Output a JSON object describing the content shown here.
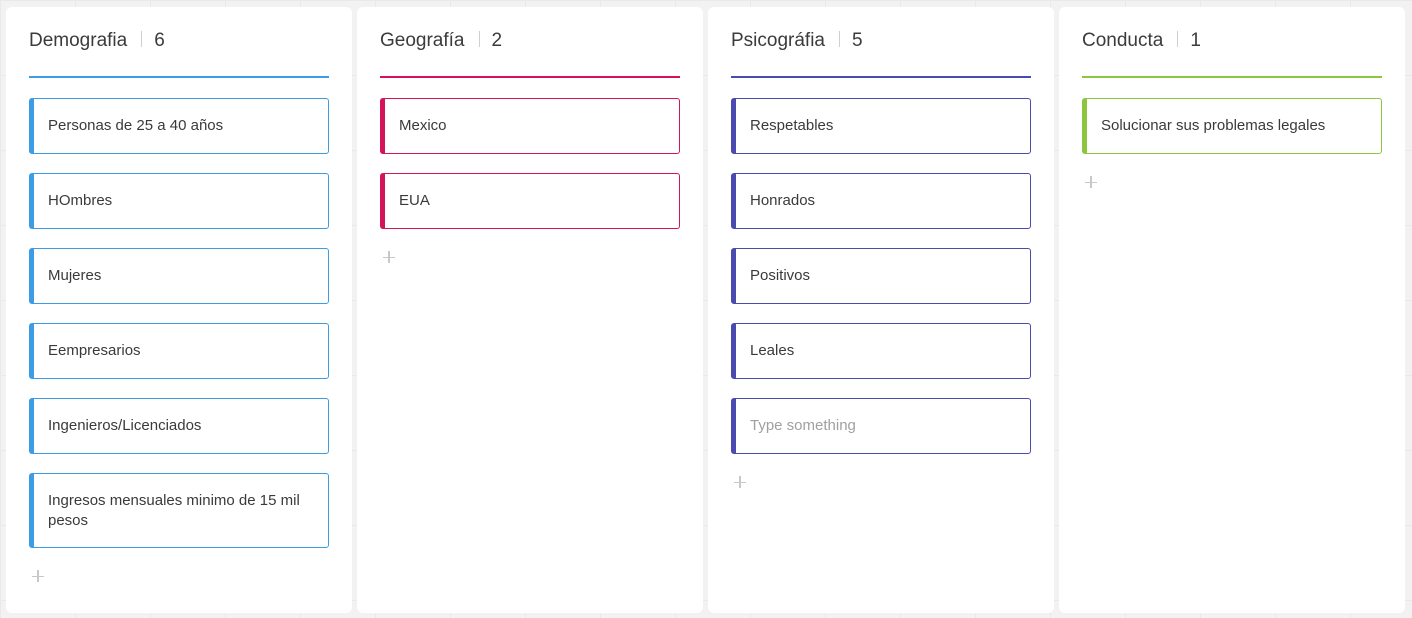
{
  "columns": [
    {
      "title": "Demografia",
      "count": "6",
      "color": "#3d9ce6",
      "cards": [
        "Personas de 25 a 40 años",
        "HOmbres",
        "Mujeres",
        "Eempresarios",
        "Ingenieros/Licenciados",
        "Ingresos mensuales minimo de 15 mil pesos"
      ]
    },
    {
      "title": "Geografía",
      "count": "2",
      "color": "#d4145a",
      "cards": [
        "Mexico",
        "EUA"
      ]
    },
    {
      "title": "Psicográfia",
      "count": "5",
      "color": "#4a4aaf",
      "cards": [
        "Respetables",
        "Honrados",
        "Positivos",
        "Leales"
      ],
      "new_card_placeholder": "Type something"
    },
    {
      "title": "Conducta",
      "count": "1",
      "color": "#8cc63f",
      "cards": [
        "Solucionar sus problemas legales"
      ]
    }
  ],
  "icons": {
    "add": "plus-icon"
  }
}
